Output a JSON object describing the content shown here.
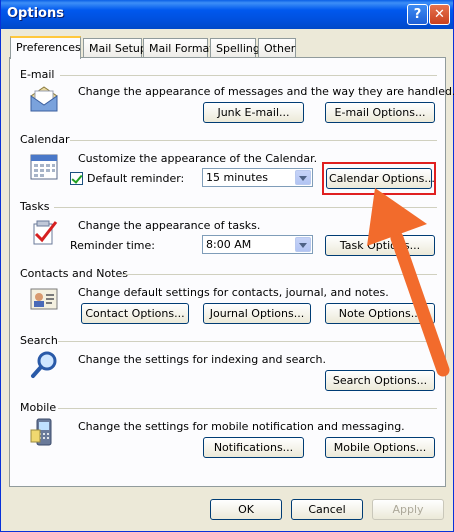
{
  "window": {
    "title": "Options",
    "help_glyph": "?",
    "close_glyph": "✕"
  },
  "tabs": [
    {
      "label": "Preferences"
    },
    {
      "label": "Mail Setup"
    },
    {
      "label": "Mail Format"
    },
    {
      "label": "Spelling"
    },
    {
      "label": "Other"
    }
  ],
  "sections": {
    "email": {
      "heading": "E-mail",
      "description": "Change the appearance of messages and the way they are handled.",
      "junk_label": "Junk E-mail...",
      "options_label": "E-mail Options..."
    },
    "calendar": {
      "heading": "Calendar",
      "description": "Customize the appearance of the Calendar.",
      "reminder_label": "Default reminder:",
      "reminder_value": "15 minutes",
      "reminder_checked": true,
      "options_label": "Calendar Options..."
    },
    "tasks": {
      "heading": "Tasks",
      "description": "Change the appearance of tasks.",
      "reminder_time_label": "Reminder time:",
      "reminder_time_value": "8:00 AM",
      "options_label": "Task Options..."
    },
    "contacts": {
      "heading": "Contacts and Notes",
      "description": "Change default settings for contacts, journal, and notes.",
      "contact_label": "Contact Options...",
      "journal_label": "Journal Options...",
      "note_label": "Note Options..."
    },
    "search": {
      "heading": "Search",
      "description": "Change the settings for indexing and search.",
      "options_label": "Search Options..."
    },
    "mobile": {
      "heading": "Mobile",
      "description": "Change the settings for mobile notification and messaging.",
      "notifications_label": "Notifications...",
      "options_label": "Mobile Options..."
    }
  },
  "footer": {
    "ok_label": "OK",
    "cancel_label": "Cancel",
    "apply_label": "Apply"
  },
  "annotation": {
    "highlight_color": "#e02020",
    "arrow_color": "#f26b2c"
  }
}
